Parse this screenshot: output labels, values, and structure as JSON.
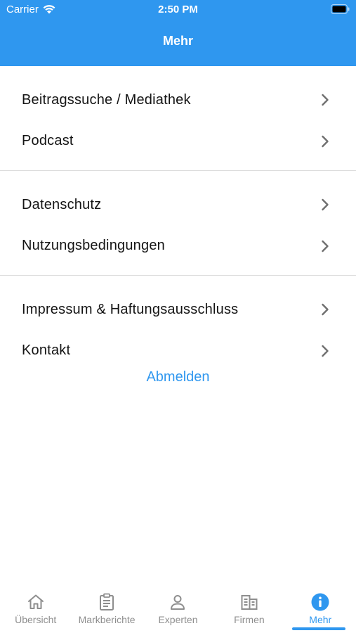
{
  "status_bar": {
    "carrier": "Carrier",
    "time": "2:50 PM"
  },
  "header": {
    "title": "Mehr"
  },
  "menu": {
    "groups": [
      {
        "items": [
          {
            "label": "Beitragssuche / Mediathek"
          },
          {
            "label": "Podcast"
          }
        ]
      },
      {
        "items": [
          {
            "label": "Datenschutz"
          },
          {
            "label": "Nutzungsbedingungen"
          }
        ]
      },
      {
        "items": [
          {
            "label": "Impressum & Haftungsausschluss"
          },
          {
            "label": "Kontakt"
          }
        ]
      }
    ]
  },
  "logout_label": "Abmelden",
  "tabbar": {
    "tabs": [
      {
        "label": "Übersicht",
        "icon": "home-icon"
      },
      {
        "label": "Markberichte",
        "icon": "clipboard-icon"
      },
      {
        "label": "Experten",
        "icon": "person-icon"
      },
      {
        "label": "Firmen",
        "icon": "building-icon"
      },
      {
        "label": "Mehr",
        "icon": "info-icon",
        "active": true
      }
    ]
  },
  "colors": {
    "accent": "#2f97ef",
    "inactive": "#8e8e8e",
    "divider": "#dcdcdc"
  }
}
